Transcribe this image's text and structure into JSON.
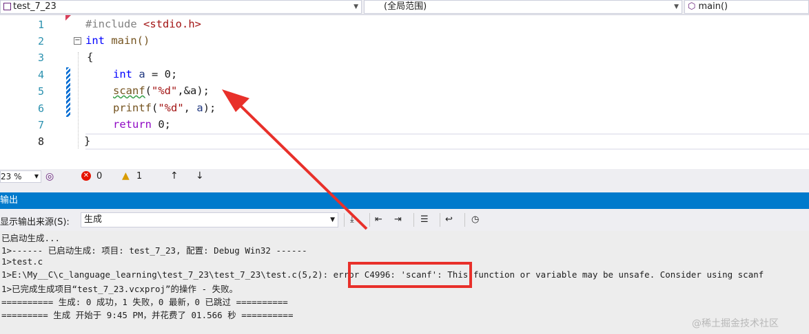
{
  "navbar": {
    "project": "test_7_23",
    "scope": "(全局范围)",
    "member": "main()"
  },
  "editor": {
    "line_numbers": [
      "1",
      "2",
      "3",
      "4",
      "5",
      "6",
      "7",
      "8"
    ],
    "lines": {
      "l1_pp": "#include ",
      "l1_inc": "<stdio.h>",
      "l2_kw": "int",
      "l2_rest": " main()",
      "l3": "{",
      "l4_kw": "int",
      "l4_var": " a",
      "l4_rest": " = 0;",
      "l5_fn": "scanf",
      "l5_p1": "(",
      "l5_str": "\"%d\"",
      "l5_rest": ",&a);",
      "l6_fn": "printf",
      "l6_p1": "(",
      "l6_str": "\"%d\"",
      "l6_rest": ", ",
      "l6_var": "a",
      "l6_end": ");",
      "l7_kw": "return",
      "l7_rest": " 0;",
      "l8": "}"
    }
  },
  "status": {
    "zoom": "23 %",
    "errors": "0",
    "warnings": "1",
    "up": "↑",
    "down": "↓"
  },
  "output": {
    "title": "输出",
    "source_label": "显示输出来源(S):",
    "source_value": "生成",
    "lines": [
      "已启动生成...",
      "1>------ 已启动生成: 项目: test_7_23, 配置: Debug Win32 ------",
      "1>test.c",
      "1>E:\\My__C\\c_language_learning\\test_7_23\\test_7_23\\test.c(5,2): error C4996: 'scanf': This function or variable may be unsafe. Consider using scanf",
      "1>已完成生成项目“test_7_23.vcxproj”的操作 - 失败。",
      "========== 生成: 0 成功，1 失败，0 最新，0 已跳过 ==========",
      "========= 生成 开始于 9:45 PM，并花费了 01.566 秒 =========="
    ]
  },
  "watermark": "@稀土掘金技术社区",
  "colors": {
    "accent": "#007acc",
    "annotation_red": "#e8302a"
  }
}
